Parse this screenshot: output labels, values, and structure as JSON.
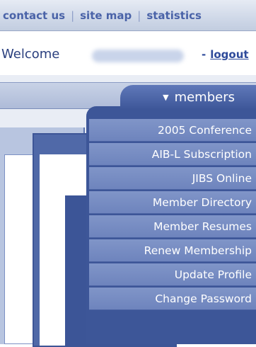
{
  "topnav": {
    "items": [
      "contact us",
      "site map",
      "statistics"
    ]
  },
  "welcome": {
    "greeting": "Welcome",
    "logout_prefix": "-",
    "logout_label": "logout"
  },
  "members_menu": {
    "label": "members",
    "items": [
      "2005 Conference",
      "AIB-L Subscription",
      "JIBS Online",
      "Member Directory",
      "Member Resumes",
      "Renew Membership",
      "Update Profile",
      "Change Password"
    ]
  },
  "colors": {
    "link_blue": "#4a63a8",
    "menu_dark": "#3d5698",
    "menu_item": "#7a8fc6"
  }
}
